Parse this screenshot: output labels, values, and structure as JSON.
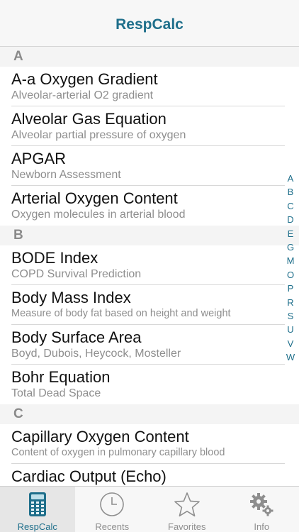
{
  "navbar": {
    "title": "RespCalc"
  },
  "sections": [
    {
      "letter": "A",
      "items": [
        {
          "title": "A-a Oxygen Gradient",
          "subtitle": "Alveolar-arterial O2 gradient"
        },
        {
          "title": "Alveolar Gas Equation",
          "subtitle": "Alveolar partial pressure of oxygen"
        },
        {
          "title": "APGAR",
          "subtitle": "Newborn Assessment"
        },
        {
          "title": "Arterial Oxygen Content",
          "subtitle": "Oxygen molecules in arterial blood"
        }
      ]
    },
    {
      "letter": "B",
      "items": [
        {
          "title": "BODE Index",
          "subtitle": "COPD Survival Prediction"
        },
        {
          "title": "Body Mass Index",
          "subtitle": "Measure of body fat based on height and weight"
        },
        {
          "title": "Body Surface Area",
          "subtitle": "Boyd, Dubois, Heycock, Mosteller"
        },
        {
          "title": "Bohr Equation",
          "subtitle": "Total Dead Space"
        }
      ]
    },
    {
      "letter": "C",
      "items": [
        {
          "title": "Capillary Oxygen Content",
          "subtitle": "Content of oxygen in pulmonary capillary blood"
        },
        {
          "title": "Cardiac Output (Echo)",
          "subtitle": ""
        }
      ]
    }
  ],
  "index": [
    "A",
    "B",
    "C",
    "D",
    "E",
    "G",
    "M",
    "O",
    "P",
    "R",
    "S",
    "U",
    "V",
    "W"
  ],
  "tabs": [
    {
      "label": "RespCalc",
      "icon": "calculator-icon",
      "active": true
    },
    {
      "label": "Recents",
      "icon": "clock-icon",
      "active": false
    },
    {
      "label": "Favorites",
      "icon": "star-icon",
      "active": false
    },
    {
      "label": "Info",
      "icon": "gears-icon",
      "active": false
    }
  ],
  "colors": {
    "accent": "#1f6f8b",
    "subtitle": "#8e8e8e",
    "section_bg": "#f4f4f4"
  }
}
